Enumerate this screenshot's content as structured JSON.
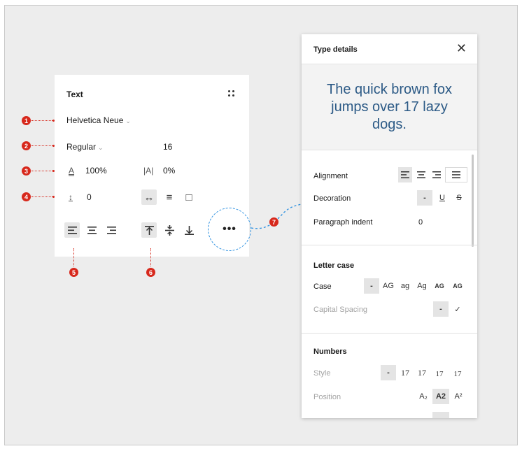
{
  "text_panel": {
    "title": "Text",
    "font_family": "Helvetica Neue",
    "font_weight": "Regular",
    "font_size": "16",
    "line_height": "100%",
    "letter_spacing": "0%",
    "paragraph_spacing": "0",
    "line_height_icon": "A",
    "letter_spacing_icon": "|A|",
    "paragraph_spacing_icon": "↕"
  },
  "markers": [
    "1",
    "2",
    "3",
    "4",
    "5",
    "6",
    "7"
  ],
  "more_button": "•••",
  "type_details": {
    "title": "Type details",
    "close": "✕",
    "preview_text": "The quick brown fox jumps over 17 lazy dogs.",
    "alignment_label": "Alignment",
    "decoration_label": "Decoration",
    "decoration_none": "-",
    "decoration_underline": "U",
    "decoration_strike": "S",
    "paragraph_indent_label": "Paragraph indent",
    "paragraph_indent_value": "0",
    "letter_case_heading": "Letter case",
    "case_label": "Case",
    "case_options": [
      "-",
      "AG",
      "ag",
      "Ag",
      "AG",
      "AG"
    ],
    "capital_spacing_label": "Capital Spacing",
    "capital_spacing_none": "-",
    "capital_spacing_check": "✓",
    "numbers_heading": "Numbers",
    "style_label": "Style",
    "style_options": [
      "-",
      "17",
      "17",
      "17",
      "17"
    ],
    "position_label": "Position",
    "position_options": [
      "A₂",
      "A2",
      "A²"
    ]
  }
}
